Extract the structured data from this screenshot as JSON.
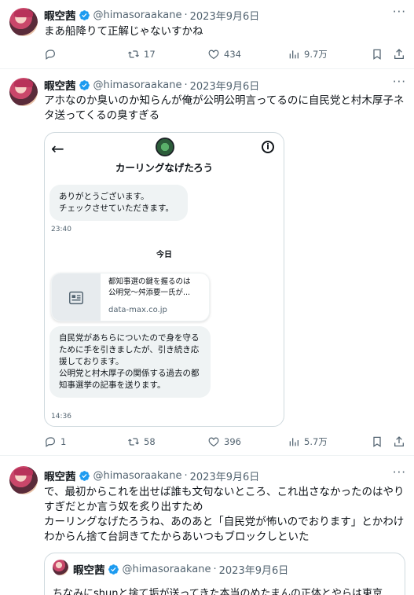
{
  "tweets": [
    {
      "name": "暇空茜",
      "handle": "@himasoraakane",
      "dot": "·",
      "date": "2023年9月6日",
      "text": "まあ船降りて正解じゃないすかね",
      "replies": "",
      "retweets": "17",
      "likes": "434",
      "views": "9.7万"
    },
    {
      "name": "暇空茜",
      "handle": "@himasoraakane",
      "dot": "·",
      "date": "2023年9月6日",
      "text": "アホなのか臭いのか知らんが俺が公明公明言ってるのに自民党と村木厚子ネタ送ってくるの臭すぎる",
      "replies": "1",
      "retweets": "58",
      "likes": "396",
      "views": "5.7万"
    },
    {
      "name": "暇空茜",
      "handle": "@himasoraakane",
      "dot": "·",
      "date": "2023年9月6日",
      "text": "で、最初からこれを出せば誰も文句ないところ、これ出さなかったのはやりすぎだとか言う奴を炙り出すため\nカーリングなげたろうね、あのあと「自民党が怖いのでおります」とかわけわからん捨て台詞きてたからあいつもブロックしといた"
    }
  ],
  "dm": {
    "title": "カーリングなげたろう",
    "info_glyph": "i",
    "message1": "ありがとうございます。\nチェックさせていただきます。",
    "time1": "23:40",
    "today": "今日",
    "link_title": "都知事選の鍵を握るのは\n公明党～舛添要一氏が...",
    "link_domain": "data-max.co.jp",
    "message2": "自民党があちらについたので身を守るために手を引きましたが、引き続き応援しております。\n公明党と村木厚子の関係する過去の都知事選挙の記事を送ります。",
    "time2": "14:36"
  },
  "quote": {
    "name": "暇空茜",
    "handle": "@himasoraakane",
    "dot": "·",
    "date": "2023年9月6日",
    "text": "ちなみにshunと捨て垢が送ってきた本当のめたまんの正体とやらは東京"
  },
  "colors": {
    "verified": "#1d9bf0",
    "muted": "#536471",
    "border": "#eff3f4"
  },
  "icons": [
    "reply-icon",
    "retweet-icon",
    "like-icon",
    "views-icon",
    "bookmark-icon",
    "share-icon",
    "verified-badge-icon",
    "more-icon",
    "back-arrow-icon",
    "info-icon",
    "article-icon"
  ]
}
